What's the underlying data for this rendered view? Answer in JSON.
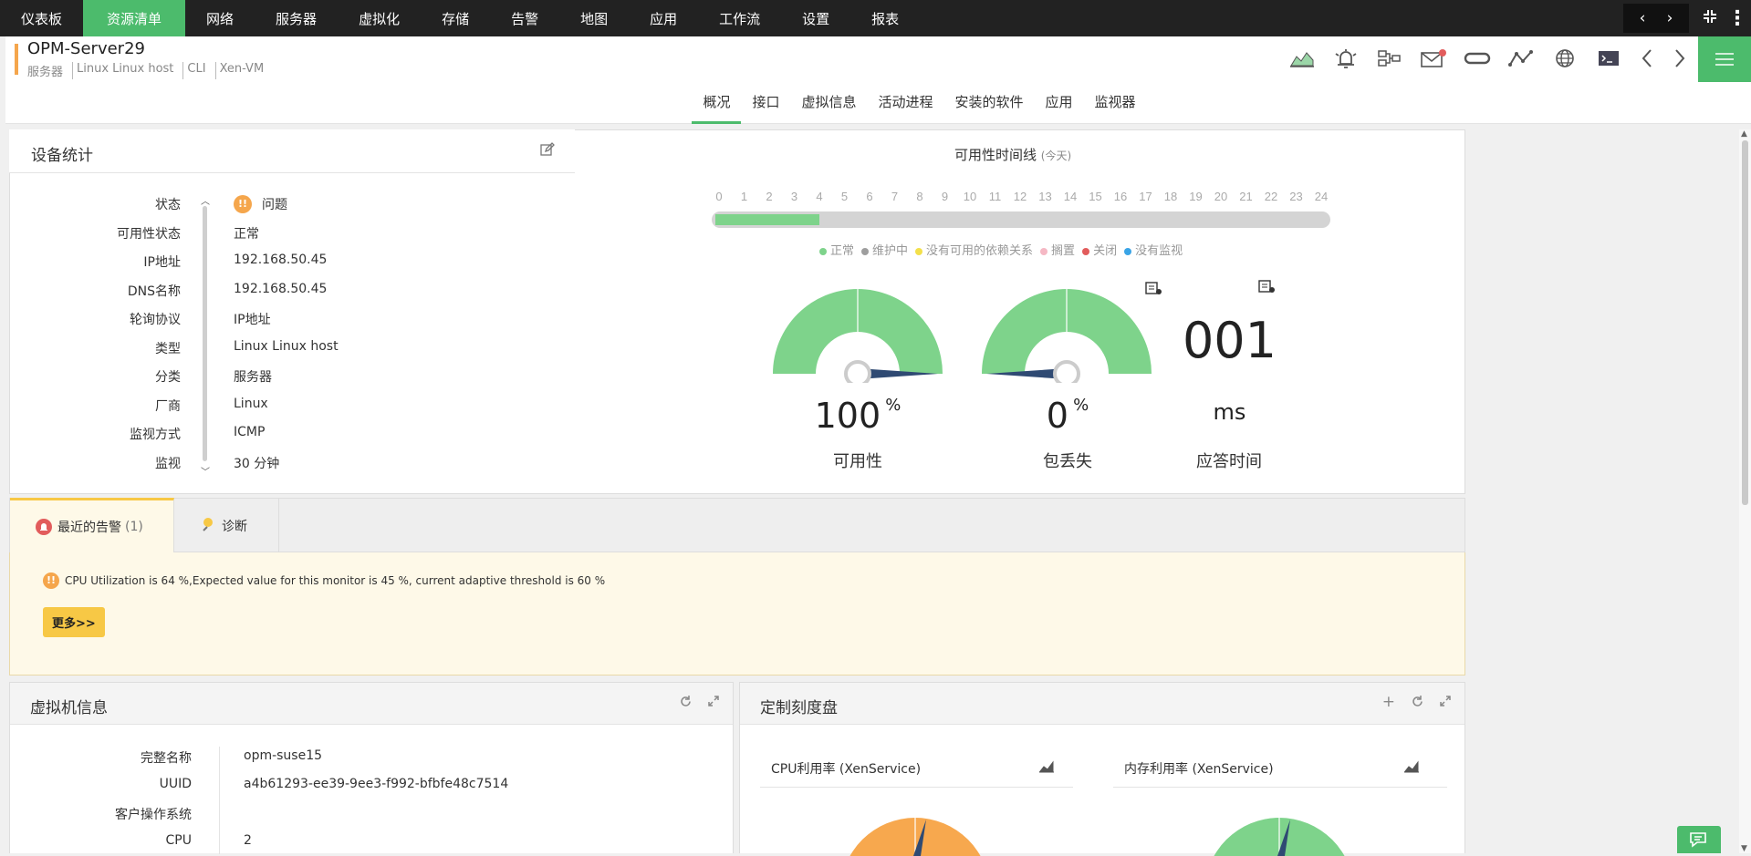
{
  "topnav": {
    "items": [
      "仪表板",
      "资源清单",
      "网络",
      "服务器",
      "虚拟化",
      "存储",
      "告警",
      "地图",
      "应用",
      "工作流",
      "设置",
      "报表"
    ],
    "active_index": 1
  },
  "device": {
    "name": "OPM-Server29",
    "meta": [
      "服务器",
      "Linux Linux host",
      "CLI",
      "Xen-VM"
    ]
  },
  "subtabs": {
    "items": [
      "概况",
      "接口",
      "虚拟信息",
      "活动进程",
      "安装的软件",
      "应用",
      "监视器"
    ],
    "active_index": 0
  },
  "device_stats": {
    "title": "设备统计",
    "rows": [
      {
        "label": "状态",
        "value": "问题"
      },
      {
        "label": "可用性状态",
        "value": "正常"
      },
      {
        "label": "IP地址",
        "value": "192.168.50.45"
      },
      {
        "label": "DNS名称",
        "value": "192.168.50.45"
      },
      {
        "label": "轮询协议",
        "value": "IP地址"
      },
      {
        "label": "类型",
        "value": "Linux Linux host"
      },
      {
        "label": "分类",
        "value": "服务器"
      },
      {
        "label": "厂商",
        "value": "Linux"
      },
      {
        "label": "监视方式",
        "value": "ICMP"
      },
      {
        "label": "监视",
        "value": "30 分钟"
      }
    ]
  },
  "availability": {
    "title": "可用性时间线",
    "title_suffix": "(今天)",
    "hours": [
      "0",
      "1",
      "2",
      "3",
      "4",
      "5",
      "6",
      "7",
      "8",
      "9",
      "10",
      "11",
      "12",
      "13",
      "14",
      "15",
      "16",
      "17",
      "18",
      "19",
      "20",
      "21",
      "22",
      "23",
      "24"
    ],
    "up_until_hour": 4,
    "legend": [
      {
        "label": "正常",
        "color": "#7ed38b"
      },
      {
        "label": "维护中",
        "color": "#9e9e9e"
      },
      {
        "label": "没有可用的依赖关系",
        "color": "#f3e04b"
      },
      {
        "label": "搁置",
        "color": "#f5b8c4"
      },
      {
        "label": "关闭",
        "color": "#e25c5c"
      },
      {
        "label": "没有监视",
        "color": "#3aa4e6"
      }
    ]
  },
  "gauges": {
    "availability": {
      "value": "100",
      "unit": "%",
      "label": "可用性",
      "fraction": 1.0
    },
    "packet_loss": {
      "value": "0",
      "unit": "%",
      "label": "包丢失",
      "fraction": 0.0
    },
    "response": {
      "value": "001",
      "unit": "ms",
      "label": "应答时间"
    }
  },
  "alert_tabs": {
    "recent": "最近的告警",
    "recent_count": "(1)",
    "diagnose": "诊断"
  },
  "alert": {
    "message": "CPU Utilization is 64 %,Expected value for this monitor is 45 %, current adaptive threshold is 60 %",
    "more": "更多>>"
  },
  "vm_info": {
    "title": "虚拟机信息",
    "rows": [
      {
        "label": "完整名称",
        "value": "opm-suse15"
      },
      {
        "label": "UUID",
        "value": "a4b61293-ee39-9ee3-f992-bfbfe48c7514"
      },
      {
        "label": "客户操作系统",
        "value": ""
      },
      {
        "label": "CPU",
        "value": "2"
      }
    ]
  },
  "custom_dials": {
    "title": "定制刻度盘",
    "dials": [
      {
        "label": "CPU利用率 (XenService)",
        "color": "#f7a84e"
      },
      {
        "label": "内存利用率 (XenService)",
        "color": "#7ed38b"
      }
    ]
  },
  "colors": {
    "accent": "#4cbb6c",
    "warning": "#f5a64c",
    "gauge_green": "#7ed38b",
    "needle": "#2f4a73"
  }
}
